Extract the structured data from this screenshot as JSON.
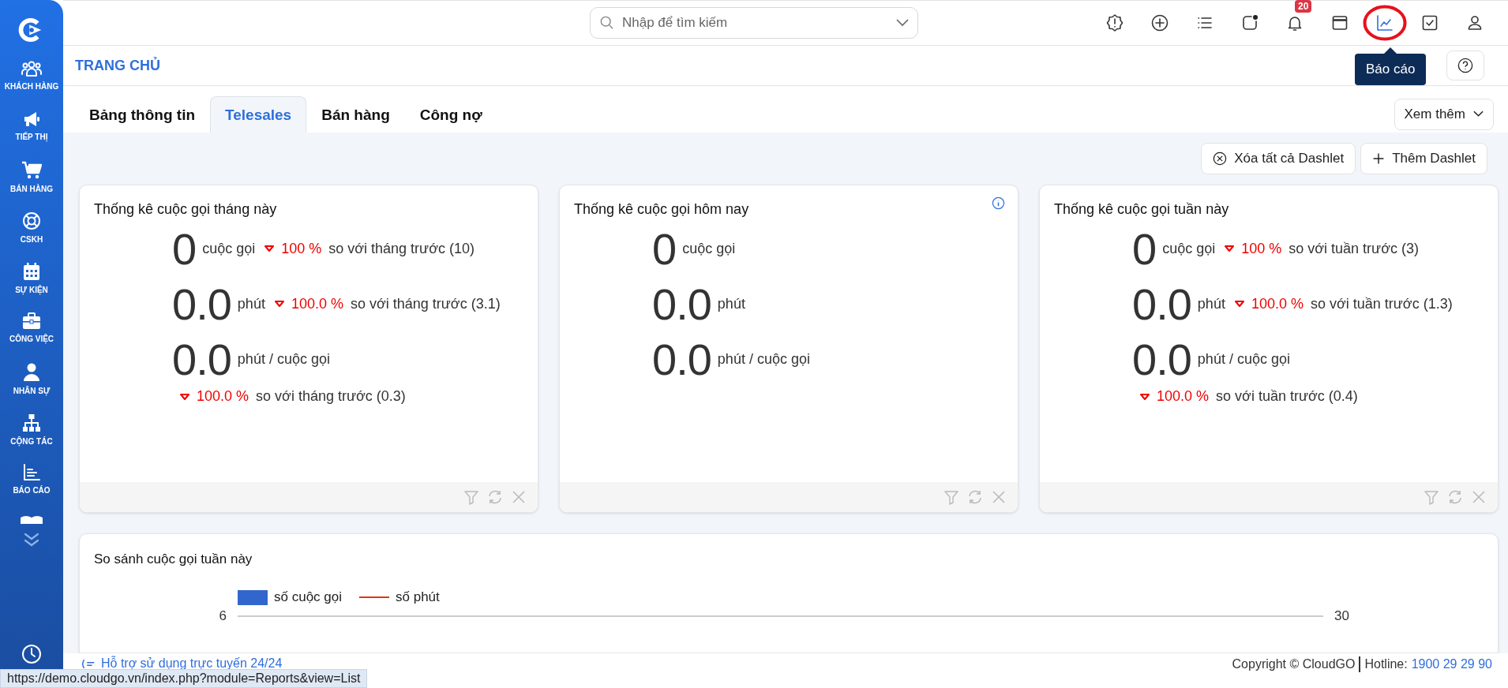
{
  "sidebar": {
    "items": [
      {
        "label": "KHÁCH HÀNG"
      },
      {
        "label": "TIẾP THỊ"
      },
      {
        "label": "BÁN HÀNG"
      },
      {
        "label": "CSKH"
      },
      {
        "label": "SỰ KIỆN"
      },
      {
        "label": "CÔNG VIỆC"
      },
      {
        "label": "NHÂN SỰ"
      },
      {
        "label": "CỘNG TÁC"
      },
      {
        "label": "BÁO CÁO"
      }
    ]
  },
  "topbar": {
    "search": {
      "placeholder": "Nhập để tìm kiếm"
    },
    "icons": [
      {
        "selected": false
      },
      {
        "selected": false
      },
      {
        "selected": false
      },
      {
        "selected": false,
        "dot": true
      },
      {
        "selected": false,
        "badge": "20"
      },
      {
        "selected": false
      },
      {
        "selected": true,
        "highlighted": true
      },
      {
        "selected": false
      },
      {
        "selected": false
      }
    ],
    "tooltip": "Báo cáo"
  },
  "page_title": "TRANG CHỦ",
  "tabs": [
    {
      "label": "Bảng thông tin",
      "selected": false
    },
    {
      "label": "Telesales",
      "selected": true
    },
    {
      "label": "Bán hàng",
      "selected": false
    },
    {
      "label": "Công nợ",
      "selected": false
    }
  ],
  "more_button": "Xem thêm",
  "actions": [
    {
      "kind": "remove",
      "label": "Xóa tất cả Dashlet"
    },
    {
      "kind": "add",
      "label": "Thêm Dashlet"
    }
  ],
  "cards": [
    {
      "title": "Thống kê cuộc gọi tháng này",
      "info": false,
      "stats": [
        {
          "kind": "inline",
          "value": "0",
          "unit": "cuộc gọi",
          "change": {
            "kind": "down",
            "percent": "100 %",
            "text": "so với tháng trước (10)"
          }
        },
        {
          "kind": "inline",
          "value": "0.0",
          "unit": "phút",
          "change": {
            "kind": "down",
            "percent": "100.0 %",
            "text": "so với tháng trước (3.1)"
          }
        },
        {
          "kind": "below",
          "value": "0.0",
          "unit": "phút / cuộc gọi",
          "change": {
            "kind": "down",
            "percent": "100.0 %",
            "text": "so với tháng trước (0.3)"
          }
        }
      ]
    },
    {
      "title": "Thống kê cuộc gọi hôm nay",
      "info": true,
      "stats": [
        {
          "kind": "inline",
          "value": "0",
          "unit": "cuộc gọi"
        },
        {
          "kind": "inline",
          "value": "0.0",
          "unit": "phút"
        },
        {
          "kind": "inline",
          "value": "0.0",
          "unit": "phút / cuộc gọi"
        }
      ]
    },
    {
      "title": "Thống kê cuộc gọi tuần này",
      "info": false,
      "stats": [
        {
          "kind": "inline",
          "value": "0",
          "unit": "cuộc gọi",
          "change": {
            "kind": "down",
            "percent": "100 %",
            "text": "so với tuần trước (3)"
          }
        },
        {
          "kind": "inline",
          "value": "0.0",
          "unit": "phút",
          "change": {
            "kind": "down",
            "percent": "100.0 %",
            "text": "so với tuần trước (1.3)"
          }
        },
        {
          "kind": "below",
          "value": "0.0",
          "unit": "phút / cuộc gọi",
          "change": {
            "kind": "down",
            "percent": "100.0 %",
            "text": "so với tuần trước (0.4)"
          }
        }
      ]
    }
  ],
  "chart_card": {
    "title": "So sánh cuộc gọi tuần này",
    "legend": [
      {
        "kind": "bar",
        "label": "số cuộc gọi",
        "color": "#3366cc"
      },
      {
        "kind": "line",
        "label": "số phút",
        "color": "#dc3912"
      }
    ],
    "left_tick": "6",
    "right_tick": "30"
  },
  "footer": {
    "support": "Hỗ trợ sử dụng trực tuyến 24/24",
    "copyright": "Copyright © CloudGO",
    "hotline_label": "Hotline:",
    "hotline": "1900 29 29 90"
  },
  "status_url": "https://demo.cloudgo.vn/index.php?module=Reports&view=List"
}
